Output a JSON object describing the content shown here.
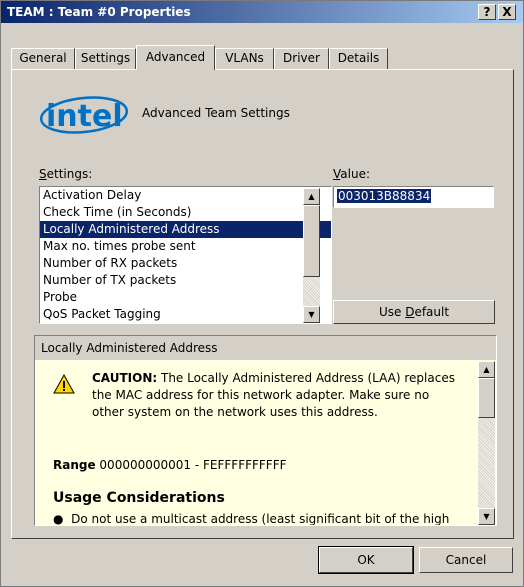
{
  "window": {
    "title": "TEAM : Team #0 Properties",
    "help_button": "?",
    "close_button": "X"
  },
  "tabs": [
    {
      "label": "General"
    },
    {
      "label": "Settings"
    },
    {
      "label": "Advanced",
      "active": true
    },
    {
      "label": "VLANs"
    },
    {
      "label": "Driver"
    },
    {
      "label": "Details"
    }
  ],
  "header": {
    "logo_text": "intel",
    "title": "Advanced Team Settings"
  },
  "settings": {
    "label_prefix": "S",
    "label_rest": "ettings:",
    "items": [
      "Activation Delay",
      "Check Time (in Seconds)",
      "Locally Administered Address",
      "Max no. times probe sent",
      "Number of RX packets",
      "Number of TX packets",
      "Probe",
      "QoS Packet Tagging"
    ],
    "selected_index": 2
  },
  "value": {
    "label_prefix": "V",
    "label_rest": "alue:",
    "text": "003013B88834"
  },
  "use_default": {
    "before": "Use ",
    "mnemonic": "D",
    "after": "efault"
  },
  "description": {
    "header": "Locally Administered Address",
    "caution_label": "CAUTION:",
    "caution_text": " The Locally Administered Address (LAA) replaces the MAC address for this network adapter. Make sure no other system on the network uses this address.",
    "range_label": "Range",
    "range_value": " 000000000001 - FEFFFFFFFFFF",
    "usage_title": "Usage Considerations",
    "bullet_text": "Do not use a multicast address (least significant bit of the high"
  },
  "footer": {
    "ok": "OK",
    "cancel": "Cancel"
  },
  "colors": {
    "selection": "#0a246a",
    "info_background": "#ffffe1",
    "dialog_face": "#d4d0c8",
    "logo_blue": "#0071c5"
  }
}
